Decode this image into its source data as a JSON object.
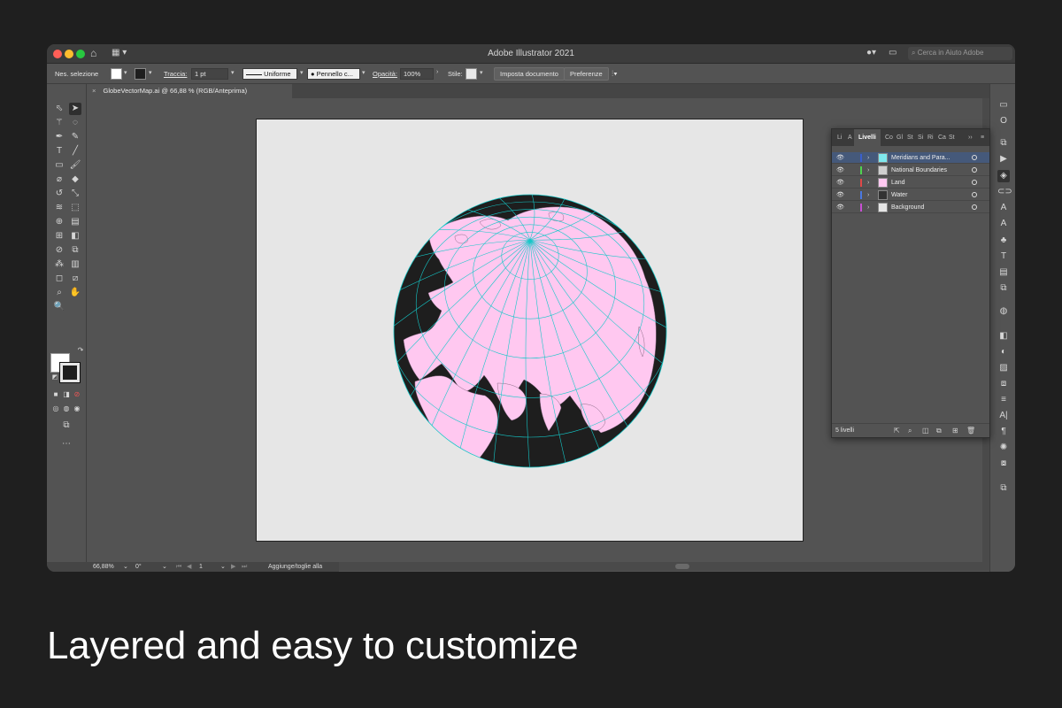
{
  "window": {
    "title": "Adobe Illustrator 2021"
  },
  "titlebar": {
    "search_placeholder": "Cerca in Aiuto Adobe"
  },
  "controlbar": {
    "selection": "Nes. selezione",
    "stroke_label": "Traccia:",
    "stroke_value": "1 pt",
    "profile_label": "Uniforme",
    "brush_label": "Pennello c...",
    "opacity_label": "Opacità:",
    "opacity_value": "100%",
    "style_label": "Stile:",
    "doc_setup_button": "Imposta documento",
    "prefs_button": "Preferenze"
  },
  "document": {
    "tab_label": "GlobeVectorMap.ai @ 66,88 % (RGB/Anteprima)"
  },
  "statusbar": {
    "zoom": "66,88%",
    "rotation": "0°",
    "artboard": "1",
    "status_text": "Aggiunge/toglie alla selezione"
  },
  "layers_panel": {
    "tabs": [
      "Li",
      "A",
      "Livelli",
      "Co",
      "Gl",
      "St",
      "Si",
      "Ri",
      "Ca",
      "St"
    ],
    "active_tab": "Livelli",
    "layers": [
      {
        "name": "Meridians and Para...",
        "color": "#3a5fcd",
        "selected": true
      },
      {
        "name": "National Boundaries",
        "color": "#4fd34f",
        "selected": false
      },
      {
        "name": "Land",
        "color": "#e04848",
        "selected": false
      },
      {
        "name": "Water",
        "color": "#4a78e0",
        "selected": false
      },
      {
        "name": "Background",
        "color": "#c84fd3",
        "selected": false
      }
    ],
    "footer_count": "5 livelli"
  },
  "caption": "Layered and easy to customize",
  "colors": {
    "land": "#ffc8f0",
    "water": "#1e1e1e",
    "graticule": "#14c8c8",
    "artboard": "#e6e6e6"
  }
}
